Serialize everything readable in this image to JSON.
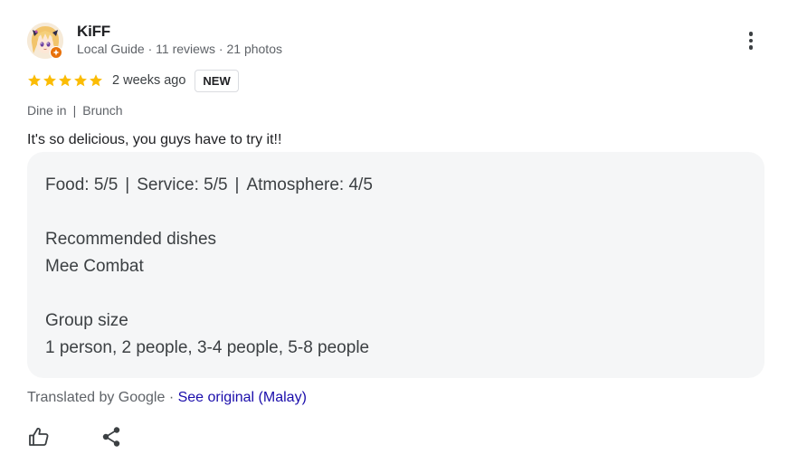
{
  "reviewer": {
    "name": "KiFF",
    "meta": "Local Guide · 11 reviews · 21 photos",
    "avatar_icon": "anime-avatar",
    "badge_icon": "local-guide-badge-icon"
  },
  "rating": {
    "stars": 5,
    "max_stars": 5,
    "star_color": "#fbbc04",
    "time": "2 weeks ago",
    "badge": "NEW"
  },
  "tags": [
    "Dine in",
    "Brunch"
  ],
  "tag_separator": "|",
  "review_text": "It's so delicious, you guys have to try it!!",
  "details": {
    "ratings": [
      {
        "label": "Food: 5/5"
      },
      {
        "label": "Service: 5/5"
      },
      {
        "label": "Atmosphere: 4/5"
      }
    ],
    "separator": "|",
    "recommended_title": "Recommended dishes",
    "recommended_value": "Mee Combat",
    "group_title": "Group size",
    "group_value": "1 person, 2 people, 3-4 people, 5-8 people"
  },
  "translation": {
    "prefix": "Translated by Google · ",
    "link": "See original (Malay)",
    "link_color": "#1a0dab"
  },
  "actions": {
    "like_icon": "thumbs-up-icon",
    "share_icon": "share-icon",
    "more_icon": "more-vertical-icon"
  }
}
